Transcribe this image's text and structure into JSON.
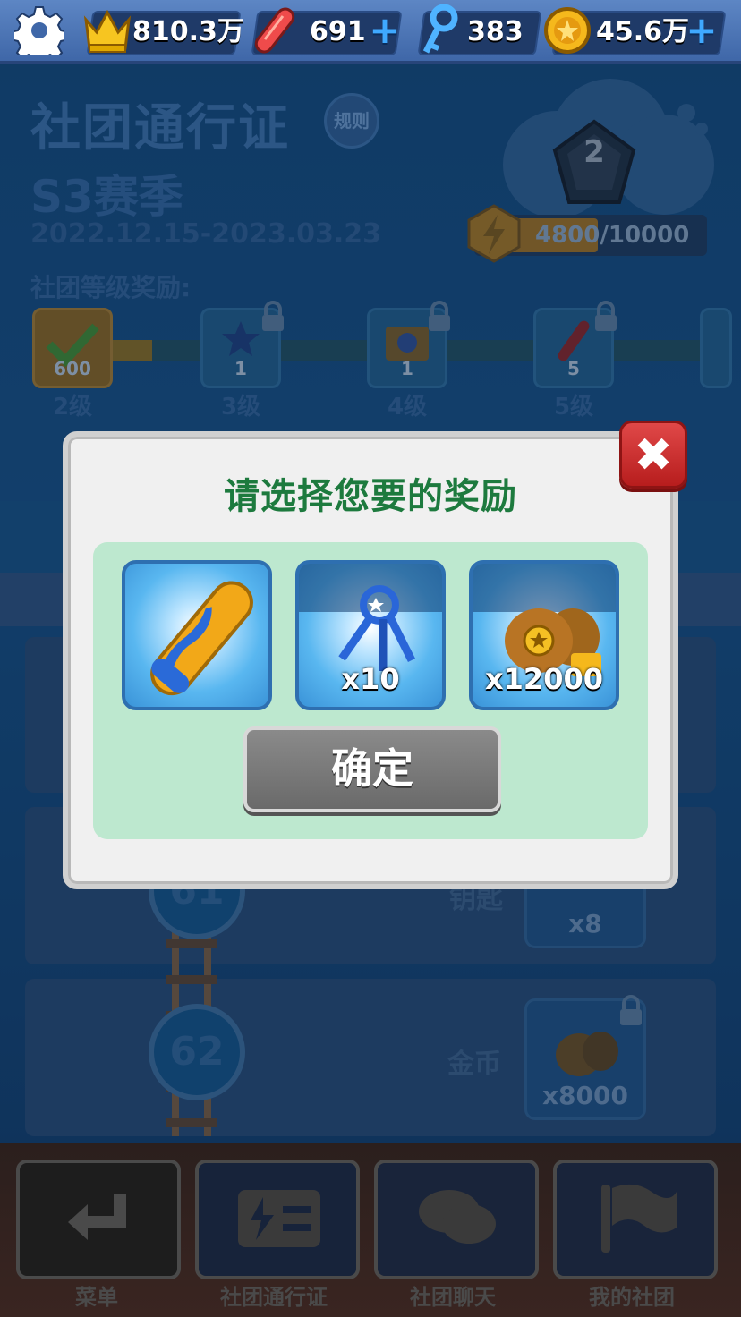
{
  "top_bar": {
    "trophies": "810.3万",
    "hoverboards": "691",
    "keys": "383",
    "coins": "45.6万",
    "icons": [
      "gear-icon",
      "crown-icon",
      "hoverboard-icon",
      "key-icon",
      "coin-icon"
    ]
  },
  "pass": {
    "title": "社团通行证",
    "rules_label": "规则",
    "season": "S3赛季",
    "dates": "2022.12.15-2023.03.23",
    "rank": "2",
    "xp": "4800/10000",
    "xp_fraction": 0.48,
    "level_rewards_title": "社团等级奖励:",
    "levels": [
      {
        "amount": "600",
        "label": "2级",
        "claimed": true
      },
      {
        "amount": "1",
        "label": "3级",
        "claimed": false
      },
      {
        "amount": "1",
        "label": "4级",
        "claimed": false
      },
      {
        "amount": "5",
        "label": "5级",
        "claimed": false
      }
    ]
  },
  "list": {
    "row2_node": "61",
    "row2_item_label": "钥匙",
    "row2_item_qty": "x8",
    "row3_node": "62",
    "row3_item_label": "金币",
    "row3_item_qty": "x8000"
  },
  "nav": {
    "items": [
      {
        "label": "菜单",
        "icon": "return-icon"
      },
      {
        "label": "社团通行证",
        "icon": "pass-icon"
      },
      {
        "label": "社团聊天",
        "icon": "chat-icon"
      },
      {
        "label": "我的社团",
        "icon": "flag-icon"
      }
    ]
  },
  "dialog": {
    "title": "请选择您要的奖励",
    "close_glyph": "✖",
    "options": [
      {
        "icon": "hoverboard-icon",
        "qty": ""
      },
      {
        "icon": "keys-icon",
        "qty": "x10"
      },
      {
        "icon": "coin-bags-icon",
        "qty": "x12000"
      }
    ],
    "confirm_label": "确定"
  },
  "colors": {
    "dialog_title": "#1d7a3e",
    "panel": "#bde8cf",
    "close": "#d23535",
    "confirm": "#7a7a7a"
  }
}
